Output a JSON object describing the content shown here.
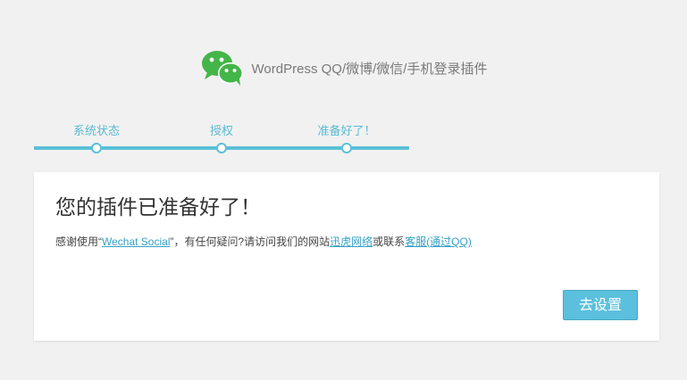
{
  "header": {
    "logo_icon": "wechat-icon",
    "title": "WordPress QQ/微博/微信/手机登录插件"
  },
  "steps": [
    {
      "label": "系统状态"
    },
    {
      "label": "授权"
    },
    {
      "label": "准备好了！"
    }
  ],
  "card": {
    "title": "您的插件已准备好了！",
    "text_prefix": "感谢使用“",
    "plugin_link": "Wechat Social",
    "text_middle": "”，有任何疑问?请访问我们的网站",
    "site_link": "迅虎网络",
    "text_or": "或联系",
    "service_link": "客服(通过QQ)",
    "button_label": "去设置"
  },
  "colors": {
    "accent": "#5bc0de",
    "step_text": "#5bbbd2",
    "link": "#34a0c4",
    "wechat_green": "#44b549"
  }
}
